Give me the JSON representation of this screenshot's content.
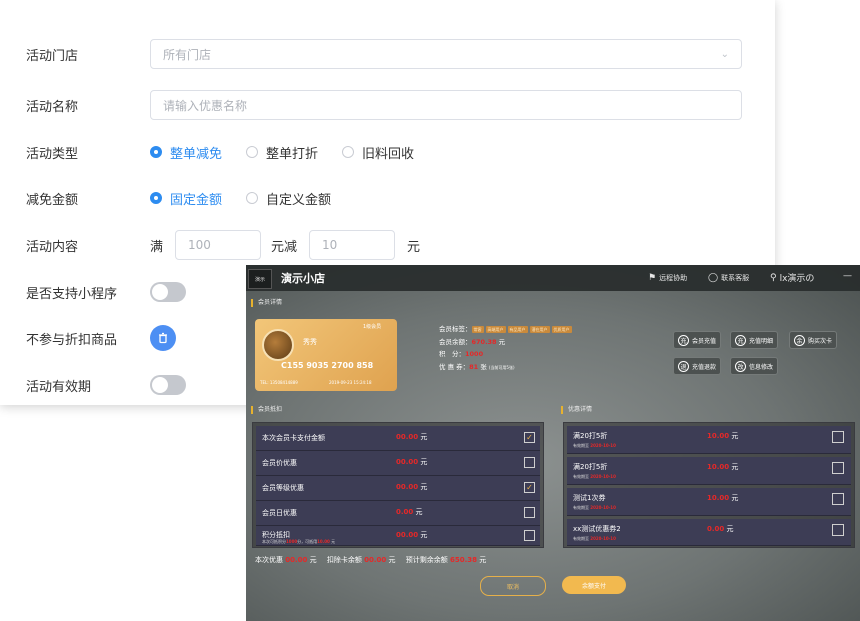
{
  "form": {
    "rows": [
      {
        "label": "活动门店"
      },
      {
        "label": "活动名称"
      },
      {
        "label": "活动类型"
      },
      {
        "label": "减免金额"
      },
      {
        "label": "活动内容"
      },
      {
        "label": "是否支持小程序"
      },
      {
        "label": "不参与折扣商品"
      },
      {
        "label": "活动有效期"
      }
    ],
    "store_select_value": "所有门店",
    "name_placeholder": "请输入优惠名称",
    "activity_types": [
      "整单减免",
      "整单打折",
      "旧料回收"
    ],
    "reduction_types": [
      "固定金额",
      "自定义金额"
    ],
    "content_prefix": "满",
    "content_min_placeholder": "100",
    "content_mid": "元减",
    "content_off_placeholder": "10",
    "content_suffix": "元",
    "toggle_miniprogram": false,
    "toggle_validity": false,
    "accent_color": "#2d8cf0"
  },
  "pos": {
    "logo_text": "演示",
    "shop_name": "演示小店",
    "remote_assist": "远程协助",
    "contact_service": "联系客服",
    "user_name": "lx演示の",
    "minimize": "—",
    "member_section": "会员详情",
    "member": {
      "level_badge": "1级会员",
      "name": "秀秀",
      "card_no": "C155 9035 2700 858",
      "tel": "TEL: 13508414889",
      "date": "2019-09-23 15:24:18",
      "tags_label": "会员标签：",
      "tags": [
        "常客",
        "高端用户",
        "有品用户",
        "潜在用户",
        "优质用户"
      ],
      "balance_label": "会员余额：",
      "balance_value": "670.38",
      "balance_unit": "元",
      "points_label": "积　分：",
      "points_value": "1000",
      "coupons_label": "优 惠 券：",
      "coupons_value": "81",
      "coupons_unit": "张",
      "coupons_note": "(当前可用5张)"
    },
    "actions": [
      {
        "icon": "充",
        "label": "会员充值"
      },
      {
        "icon": "充",
        "label": "充值明细"
      },
      {
        "icon": "余",
        "label": "购买次卡"
      },
      {
        "icon": "退",
        "label": "充值退款"
      },
      {
        "icon": "改",
        "label": "信息修改"
      }
    ],
    "settlement_section": "会员抵扣",
    "settlement_items": [
      {
        "name": "本次会员卡支付金额",
        "amount": "00.00",
        "unit": "元",
        "checked": true
      },
      {
        "name": "会员价优惠",
        "amount": "00.00",
        "unit": "元",
        "checked": false
      },
      {
        "name": "会员等级优惠",
        "amount": "00.00",
        "unit": "元",
        "checked": true
      },
      {
        "name": "会员日优惠",
        "amount": "0.00",
        "unit": "元",
        "checked": false
      },
      {
        "name": "积分抵扣",
        "amount": "00.00",
        "unit": "元",
        "checked": false,
        "sub_prefix": "本次可抵积分",
        "sub_value1": "1000",
        "sub_mid": "分，可抵用",
        "sub_value2": "10.00",
        "sub_suffix": "元"
      }
    ],
    "coupon_section": "优惠详情",
    "coupon_items": [
      {
        "name": "满20打5折",
        "validity_label": "有效期至",
        "validity": "2020-10-10",
        "amount": "10.00",
        "unit": "元"
      },
      {
        "name": "满20打5折",
        "validity_label": "有效期至",
        "validity": "2020-10-10",
        "amount": "10.00",
        "unit": "元"
      },
      {
        "name": "测试1次券",
        "validity_label": "有效期至",
        "validity": "2020-10-10",
        "amount": "10.00",
        "unit": "元"
      },
      {
        "name": "xx测试优惠券2",
        "validity_label": "有效期至",
        "validity": "2020-10-10",
        "amount": "0.00",
        "unit": "元"
      }
    ],
    "summary": {
      "discount_label": "本次优惠",
      "discount_value": "00.00",
      "discount_unit": "元",
      "card_deduct_label": "扣除卡余额",
      "card_deduct_value": "00.00",
      "card_deduct_unit": "元",
      "remaining_label": "预计剩余余额",
      "remaining_value": "650.38",
      "remaining_unit": "元"
    },
    "cancel_label": "取消",
    "pay_label": "余额支付"
  }
}
